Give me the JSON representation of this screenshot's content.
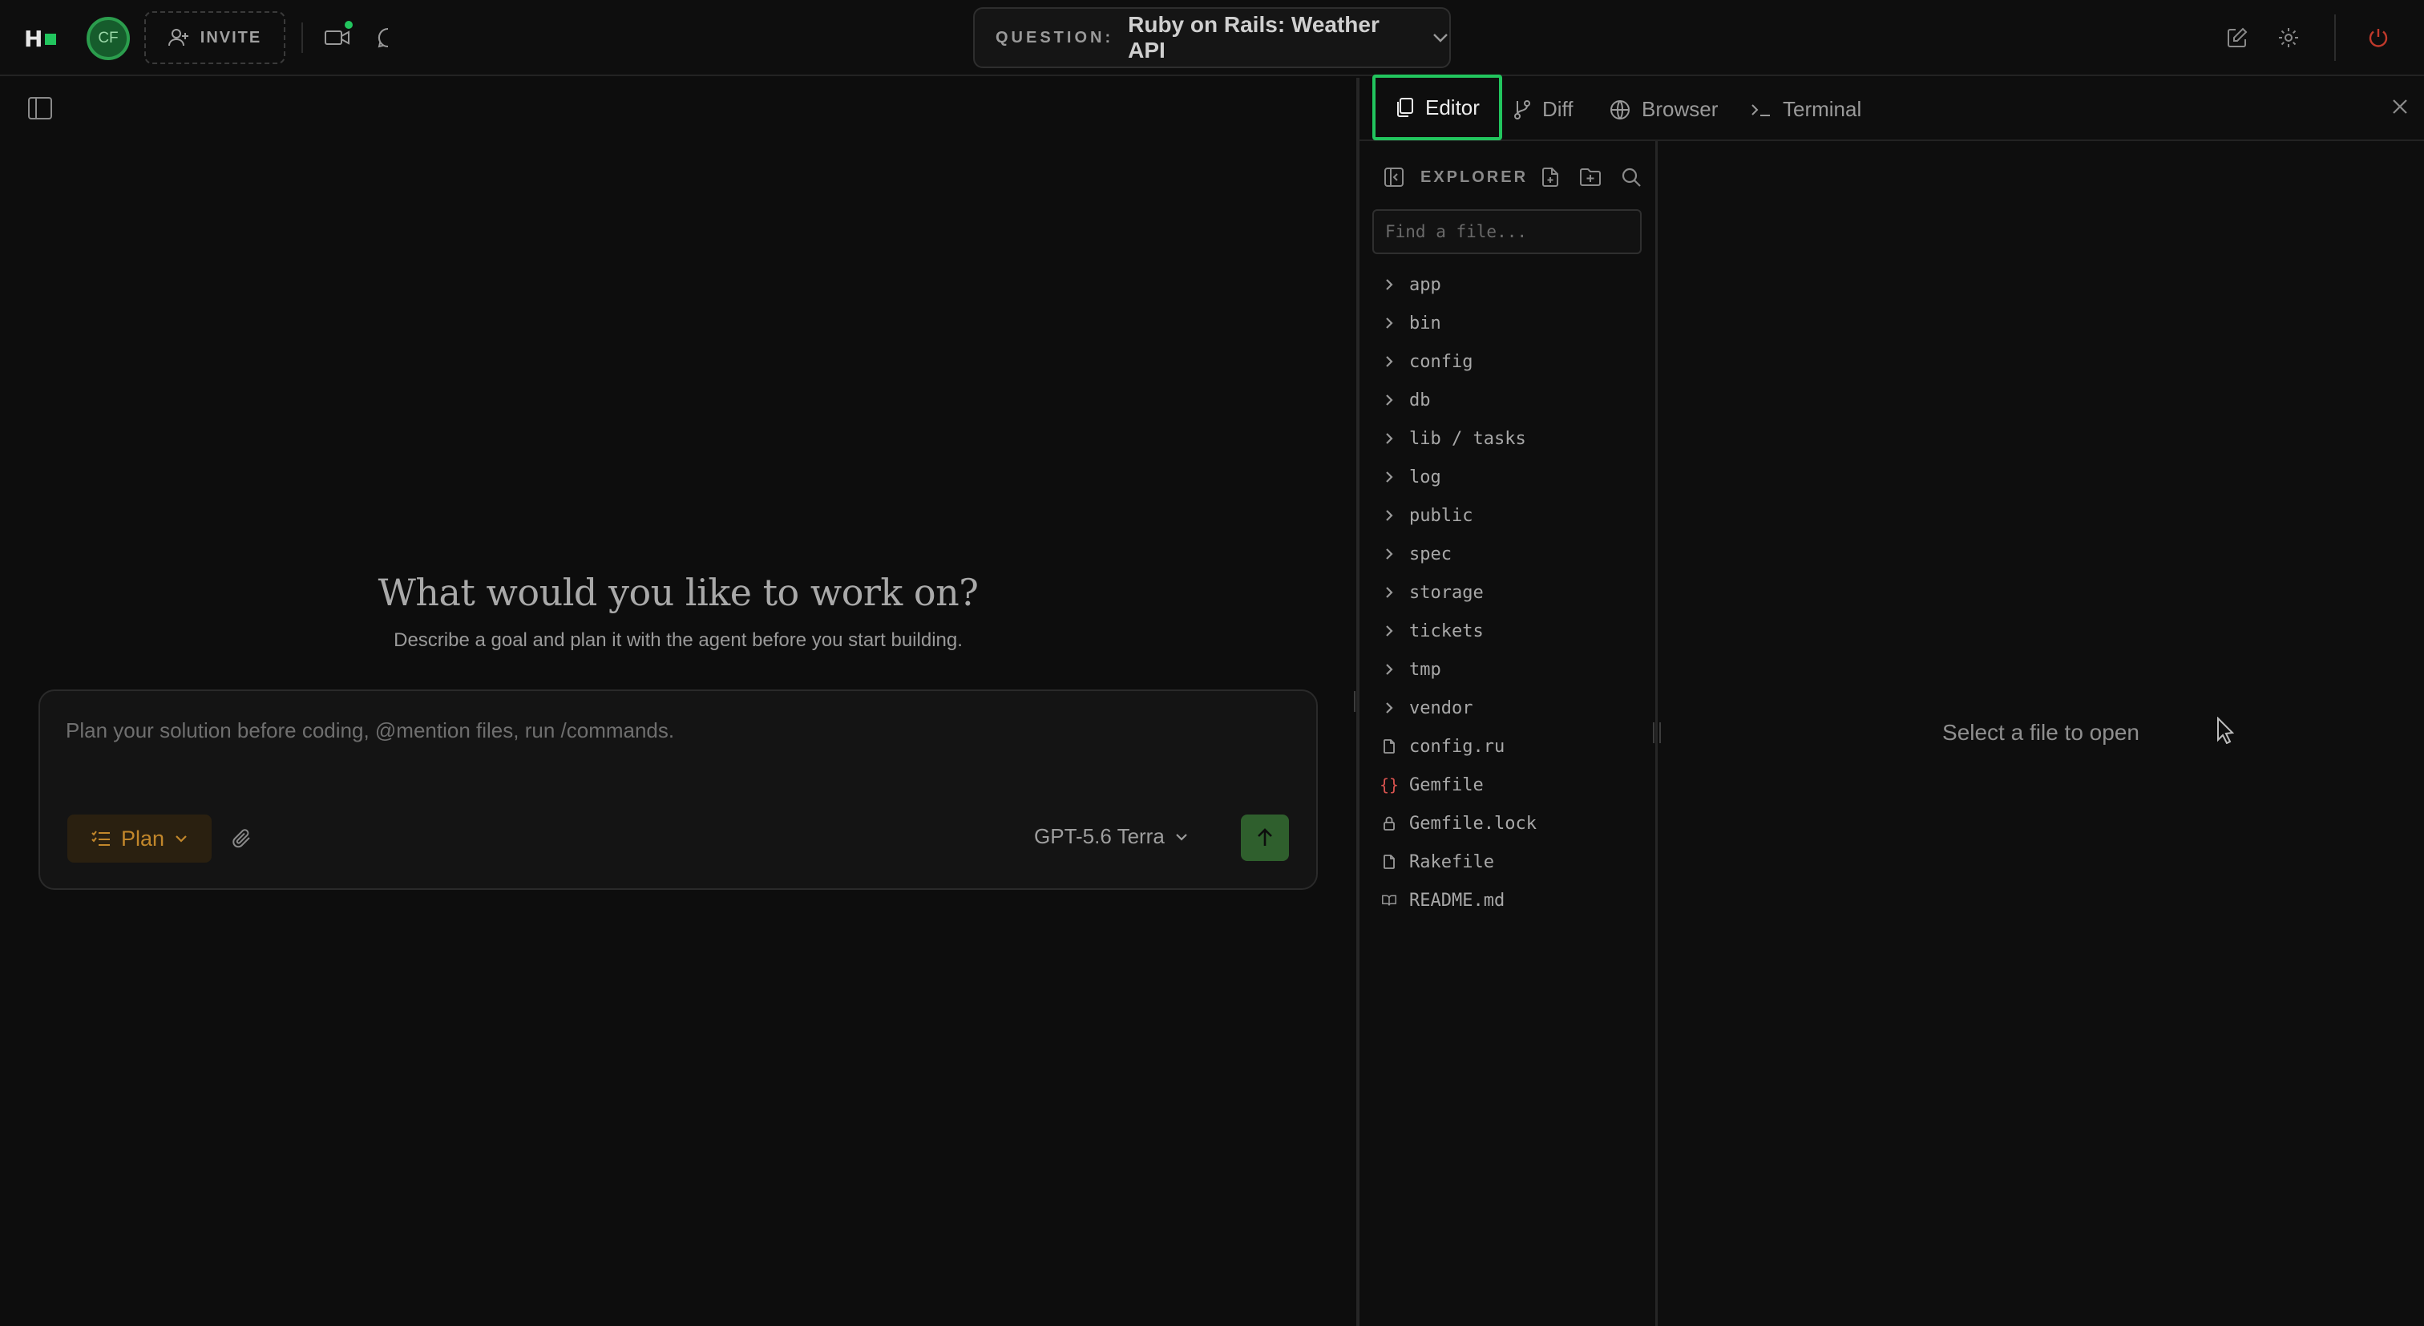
{
  "header": {
    "logo": "H",
    "avatar_initials": "CF",
    "invite_label": "INVITE",
    "question_label": "QUESTION:",
    "question_title": "Ruby on Rails: Weather API"
  },
  "hero": {
    "title": "What would you like to work on?",
    "subtitle": "Describe a goal and plan it with the agent before you start building."
  },
  "composer": {
    "placeholder": "Plan your solution before coding, @mention files, run /commands.",
    "mode_label": "Plan",
    "model_label": "GPT-5.6 Terra"
  },
  "tabs": [
    {
      "label": "Editor",
      "active": true
    },
    {
      "label": "Diff",
      "active": false
    },
    {
      "label": "Browser",
      "active": false
    },
    {
      "label": "Terminal",
      "active": false
    }
  ],
  "explorer": {
    "title": "EXPLORER",
    "search_placeholder": "Find a file...",
    "items": [
      {
        "name": "app",
        "type": "folder"
      },
      {
        "name": "bin",
        "type": "folder"
      },
      {
        "name": "config",
        "type": "folder"
      },
      {
        "name": "db",
        "type": "folder"
      },
      {
        "name": "lib / tasks",
        "type": "folder"
      },
      {
        "name": "log",
        "type": "folder"
      },
      {
        "name": "public",
        "type": "folder"
      },
      {
        "name": "spec",
        "type": "folder"
      },
      {
        "name": "storage",
        "type": "folder"
      },
      {
        "name": "tickets",
        "type": "folder"
      },
      {
        "name": "tmp",
        "type": "folder"
      },
      {
        "name": "vendor",
        "type": "folder"
      },
      {
        "name": "config.ru",
        "type": "file"
      },
      {
        "name": "Gemfile",
        "type": "gemfile"
      },
      {
        "name": "Gemfile.lock",
        "type": "lock"
      },
      {
        "name": "Rakefile",
        "type": "file"
      },
      {
        "name": "README.md",
        "type": "readme"
      }
    ]
  },
  "editor": {
    "empty_message": "Select a file to open"
  },
  "colors": {
    "accent": "#22c55e",
    "plan": "#c2872b",
    "background": "#0d0d0d",
    "power": "#c0392b"
  }
}
